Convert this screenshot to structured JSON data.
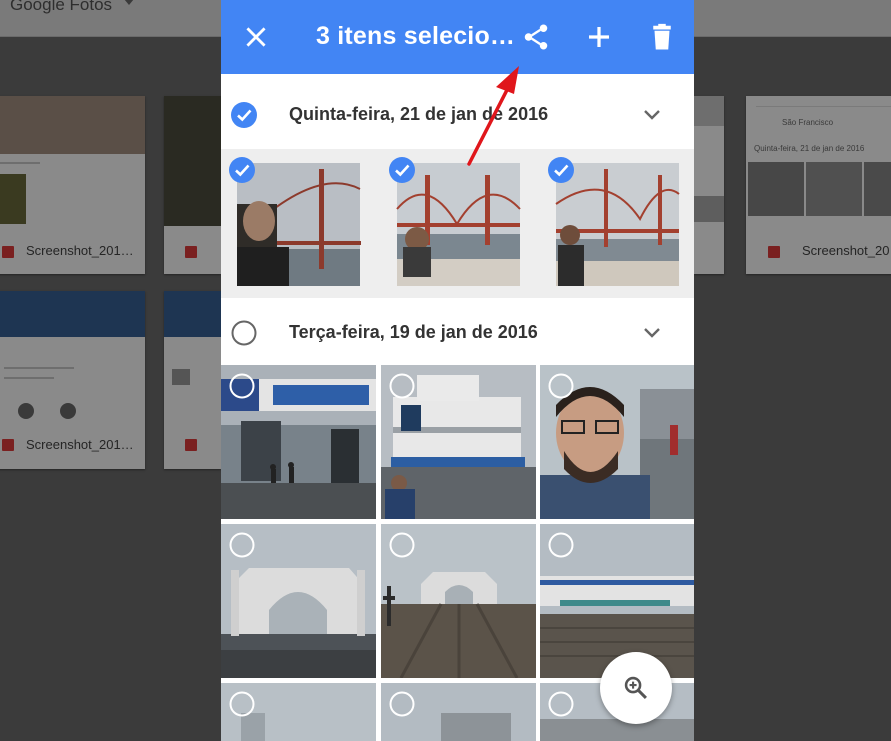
{
  "background": {
    "app_title": "Google Fotos",
    "cards": [
      {
        "label": "Screenshot_201…"
      },
      {
        "label": "Screenshot_20"
      },
      {
        "label": "Screenshot_201…"
      }
    ],
    "mini_date": "Quinta-feira, 21 de jan de 2016",
    "mini_place": "São Francisco"
  },
  "appbar": {
    "title": "3 itens selecio…",
    "icons": [
      "close-icon",
      "share-icon",
      "add-icon",
      "trash-icon"
    ]
  },
  "sections": [
    {
      "date": "Quinta-feira, 21 de jan de 2016",
      "selected": true
    },
    {
      "date": "Terça-feira, 19 de jan de 2016",
      "selected": false
    }
  ],
  "fab": {
    "icon": "zoom-in-icon"
  },
  "colors": {
    "accent": "#4285f4",
    "annotation_arrow": "#e0161b",
    "dim_overlay": "#3b3b3b"
  }
}
